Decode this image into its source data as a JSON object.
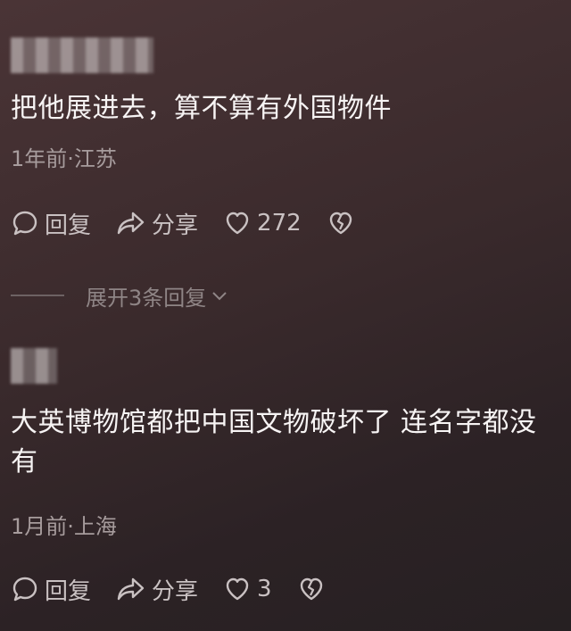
{
  "comments": [
    {
      "text": "把他展进去，算不算有外国物件",
      "meta": "1年前·江苏",
      "actions": {
        "reply": "回复",
        "share": "分享",
        "likes": "272"
      }
    },
    {
      "text": "大英博物馆都把中国文物破坏了  连名字都没有",
      "meta": "1月前·上海",
      "actions": {
        "reply": "回复",
        "share": "分享",
        "likes": "3"
      }
    }
  ],
  "expand_replies": "展开3条回复",
  "icons": {
    "reply": "speech-bubble-icon",
    "share": "share-arrow-icon",
    "like": "heart-icon",
    "dislike": "broken-heart-icon",
    "expand": "chevron-down-icon"
  }
}
